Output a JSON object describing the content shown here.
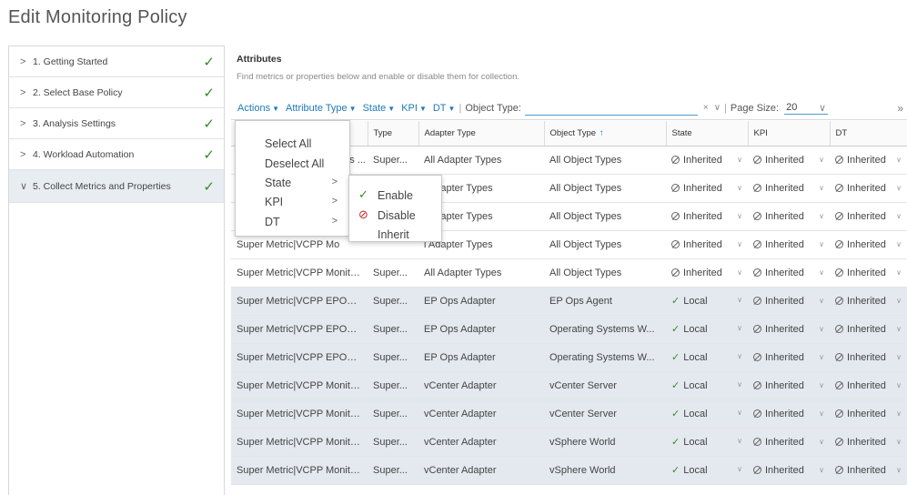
{
  "page": {
    "title": "Edit Monitoring Policy"
  },
  "steps": [
    {
      "label": "1. Getting Started",
      "done": true
    },
    {
      "label": "2. Select Base Policy",
      "done": true
    },
    {
      "label": "3. Analysis Settings",
      "done": true
    },
    {
      "label": "4. Workload Automation",
      "done": true
    },
    {
      "label": "5. Collect Metrics and Properties",
      "done": true,
      "active": true
    }
  ],
  "attributes": {
    "title": "Attributes",
    "description": "Find metrics or properties below and enable or disable them for collection."
  },
  "toolbar": {
    "actions": "Actions",
    "attribute_type": "Attribute Type",
    "state": "State",
    "kpi": "KPI",
    "dt": "DT",
    "object_type_label": "Object Type:",
    "object_type_value": "",
    "clear": "×",
    "page_size_label": "Page Size:",
    "page_size_value": "20",
    "more": "»"
  },
  "columns": {
    "type": "Type",
    "adapter_type": "Adapter Type",
    "object_type": "Object Type",
    "state": "State",
    "kpi": "KPI",
    "dt": "DT"
  },
  "rows": [
    {
      "name": "",
      "type": "Super...",
      "adapter": "All Adapter Types",
      "object": "All Object Types",
      "state": "Inherited",
      "kpi": "Inherited",
      "dt": "Inherited",
      "selected": false
    },
    {
      "name": "",
      "type": "",
      "adapter": "l Adapter Types",
      "object": "All Object Types",
      "state": "Inherited",
      "kpi": "Inherited",
      "dt": "Inherited",
      "selected": false
    },
    {
      "name": "",
      "type": "",
      "adapter": "l Adapter Types",
      "object": "All Object Types",
      "state": "Inherited",
      "kpi": "Inherited",
      "dt": "Inherited",
      "selected": false
    },
    {
      "name": "Super Metric|VCPP Mo",
      "type": "",
      "adapter": "l Adapter Types",
      "object": "All Object Types",
      "state": "Inherited",
      "kpi": "Inherited",
      "dt": "Inherited",
      "selected": false
    },
    {
      "name": "Super Metric|VCPP Monito...",
      "type": "Super...",
      "adapter": "All Adapter Types",
      "object": "All Object Types",
      "state": "Inherited",
      "kpi": "Inherited",
      "dt": "Inherited",
      "selected": false
    },
    {
      "name": "Super Metric|VCPP EPOps ...",
      "type": "Super...",
      "adapter": "EP Ops Adapter",
      "object": "EP Ops Agent",
      "state": "Local",
      "kpi": "Inherited",
      "dt": "Inherited",
      "selected": true
    },
    {
      "name": "Super Metric|VCPP EPOps ...",
      "type": "Super...",
      "adapter": "EP Ops Adapter",
      "object": "Operating Systems W...",
      "state": "Local",
      "kpi": "Inherited",
      "dt": "Inherited",
      "selected": true
    },
    {
      "name": "Super Metric|VCPP EPOps ...",
      "type": "Super...",
      "adapter": "EP Ops Adapter",
      "object": "Operating Systems W...",
      "state": "Local",
      "kpi": "Inherited",
      "dt": "Inherited",
      "selected": true
    },
    {
      "name": "Super Metric|VCPP Monito...",
      "type": "Super...",
      "adapter": "vCenter Adapter",
      "object": "vCenter Server",
      "state": "Local",
      "kpi": "Inherited",
      "dt": "Inherited",
      "selected": true
    },
    {
      "name": "Super Metric|VCPP Monito...",
      "type": "Super...",
      "adapter": "vCenter Adapter",
      "object": "vCenter Server",
      "state": "Local",
      "kpi": "Inherited",
      "dt": "Inherited",
      "selected": true
    },
    {
      "name": "Super Metric|VCPP Monito...",
      "type": "Super...",
      "adapter": "vCenter Adapter",
      "object": "vSphere World",
      "state": "Local",
      "kpi": "Inherited",
      "dt": "Inherited",
      "selected": true
    },
    {
      "name": "Super Metric|VCPP Monito...",
      "type": "Super...",
      "adapter": "vCenter Adapter",
      "object": "vSphere World",
      "state": "Local",
      "kpi": "Inherited",
      "dt": "Inherited",
      "selected": true
    }
  ],
  "row0_name_partial": "Ops ...",
  "actions_menu": {
    "select_all": "Select All",
    "deselect_all": "Deselect All",
    "state": "State",
    "kpi": "KPI",
    "dt": "DT"
  },
  "state_submenu": {
    "enable": "Enable",
    "disable": "Disable",
    "inherit": "Inherit"
  },
  "colors": {
    "link": "#1c7bb8",
    "check": "#3a8a28",
    "disable": "#c62828",
    "selected_row": "#e3e9ef"
  }
}
